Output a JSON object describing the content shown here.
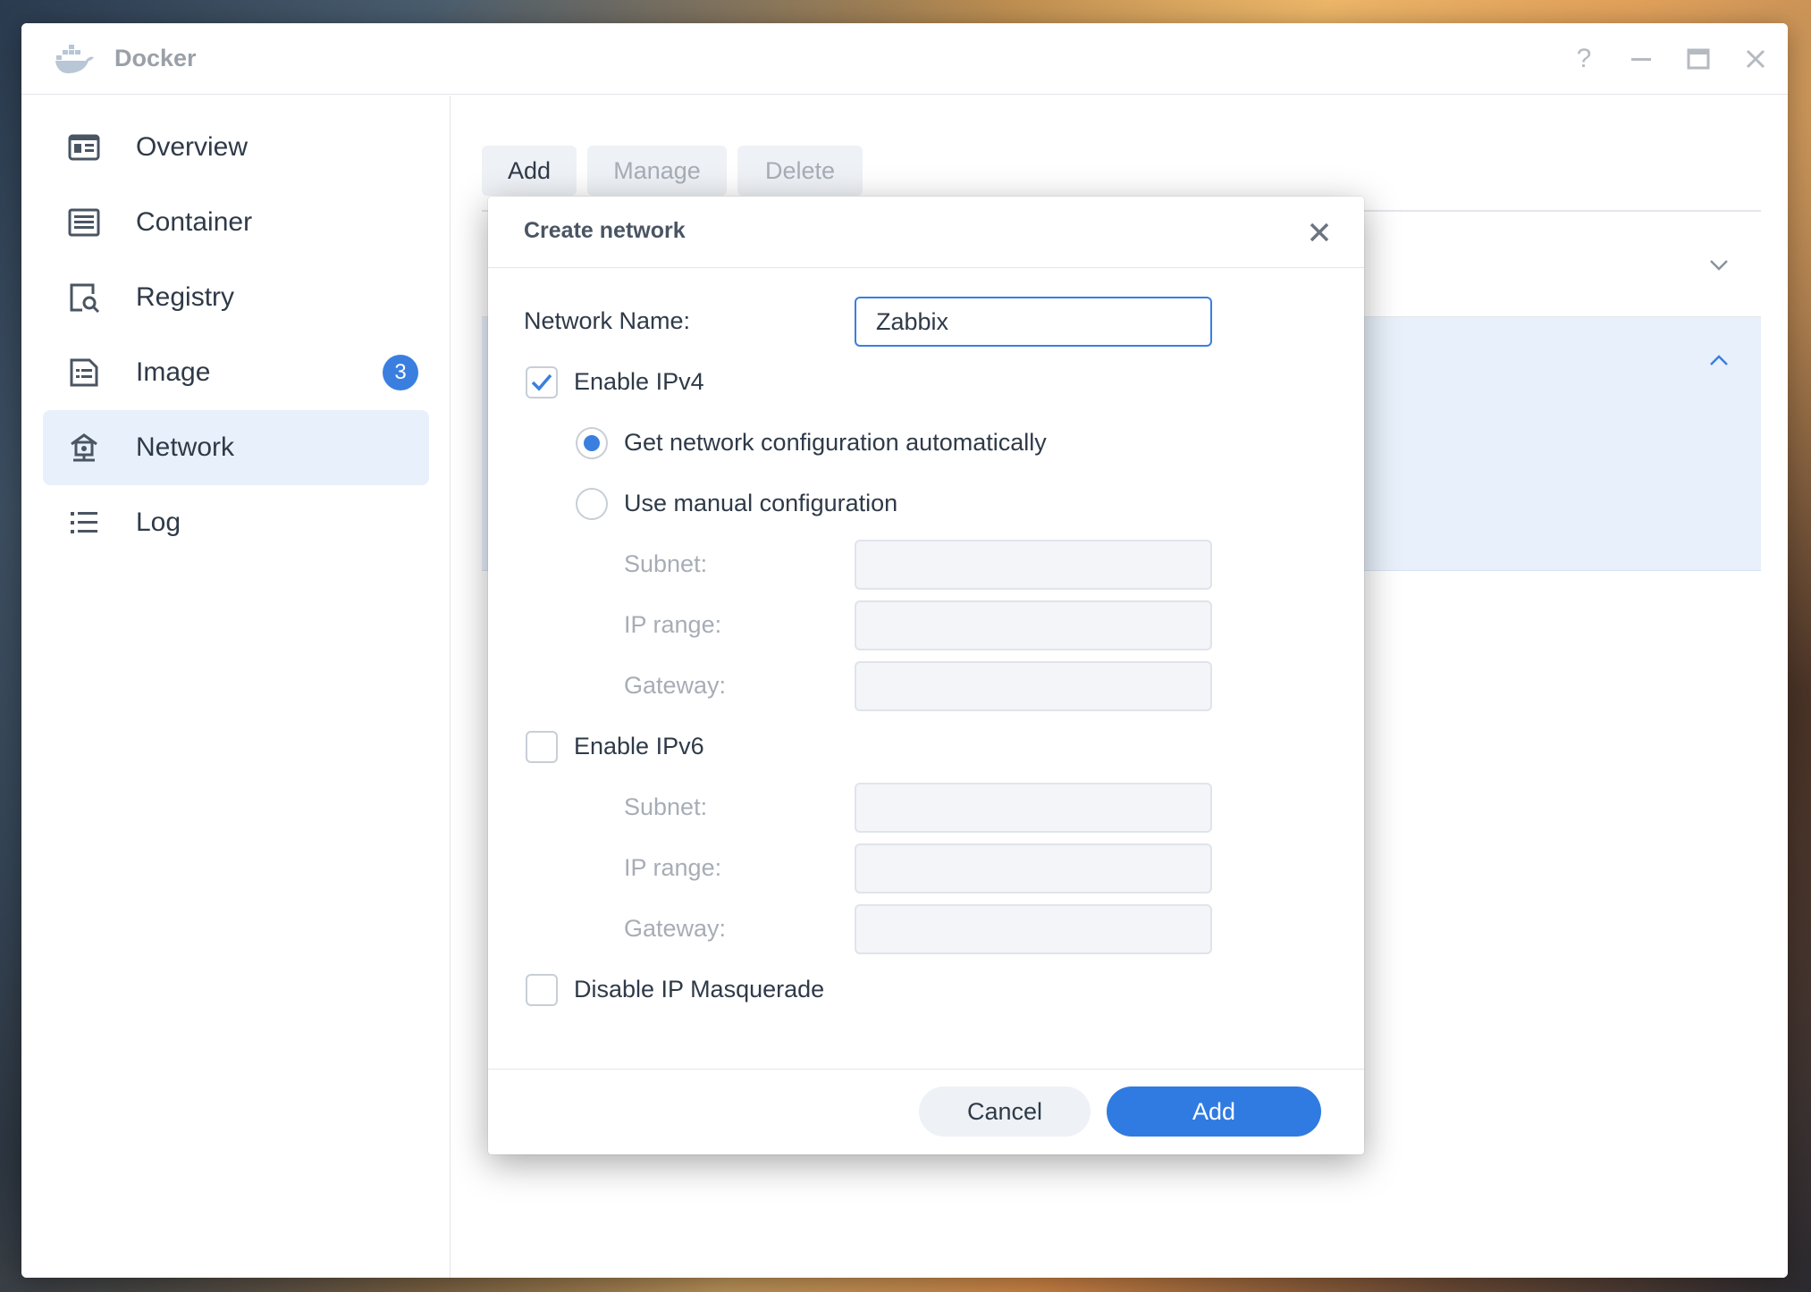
{
  "window": {
    "title": "Docker",
    "controls": {
      "help": "?",
      "minimize": "—",
      "maximize": "▭",
      "close": "✕"
    }
  },
  "sidebar": {
    "items": [
      {
        "label": "Overview",
        "icon": "overview-icon"
      },
      {
        "label": "Container",
        "icon": "container-icon"
      },
      {
        "label": "Registry",
        "icon": "registry-icon"
      },
      {
        "label": "Image",
        "icon": "image-icon",
        "badge": "3"
      },
      {
        "label": "Network",
        "icon": "network-icon",
        "active": true
      },
      {
        "label": "Log",
        "icon": "log-icon"
      }
    ]
  },
  "toolbar": {
    "add_label": "Add",
    "manage_label": "Manage",
    "delete_label": "Delete"
  },
  "dialog": {
    "title": "Create network",
    "network_name_label": "Network Name:",
    "network_name_value": "Zabbix",
    "enable_ipv4_label": "Enable IPv4",
    "enable_ipv4_checked": true,
    "auto_config_label": "Get network configuration automatically",
    "manual_config_label": "Use manual configuration",
    "ipv4": {
      "subnet_label": "Subnet:",
      "ip_range_label": "IP range:",
      "gateway_label": "Gateway:"
    },
    "enable_ipv6_label": "Enable IPv6",
    "enable_ipv6_checked": false,
    "ipv6": {
      "subnet_label": "Subnet:",
      "ip_range_label": "IP range:",
      "gateway_label": "Gateway:"
    },
    "disable_masquerade_label": "Disable IP Masquerade",
    "disable_masquerade_checked": false,
    "cancel_label": "Cancel",
    "add_label": "Add"
  },
  "colors": {
    "accent": "#2f7be2",
    "active_nav_bg": "#e8f0fb",
    "muted_text": "#a7adb6"
  }
}
